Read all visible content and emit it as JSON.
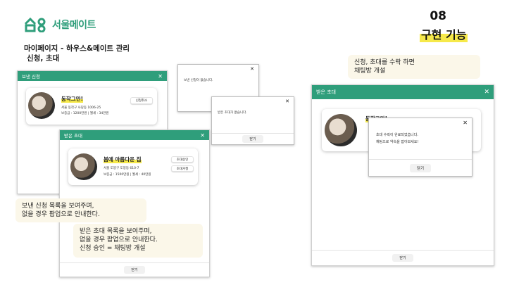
{
  "brand": {
    "name": "서울메이트"
  },
  "slide": {
    "number": "08",
    "title": "구현 기능"
  },
  "subtitle": {
    "line1": "마이페이지 - 하우스&메이트 관리",
    "line2": "신청, 초대"
  },
  "sent": {
    "header": "보낸 신청",
    "card": {
      "title": "동작그만!",
      "address": "서울 동작구 사당동 1006-25",
      "price": "보증금 : 1200만원 | 월세 : 34만원",
      "button": "신청취소"
    }
  },
  "popup_sent_empty": {
    "message": "보낸 신청이 없습니다."
  },
  "popup_received_empty": {
    "message": "받은 초대가 없습니다.",
    "button": "닫기"
  },
  "received": {
    "header": "받은 초대",
    "card": {
      "title": "봄에 아름다운 집",
      "address": "서울 도봉구 도봉동 610-7",
      "price": "보증금 : 1500만원 | 월세 : 40만원",
      "accept": "초대승인",
      "reject": "초대거절"
    },
    "close": "닫기"
  },
  "notes": {
    "sent": "보낸 신청 목록을 보여주며,\n없을 경우 팝업으로 안내한다.",
    "received": "받은 초대  목록을 보여주며,\n없을 경우 팝업으로 안내한다.\n신청 승인 = 채팅방 개설",
    "accept": "신청, 초대를 수락 하면\n채팅방 개설"
  },
  "right": {
    "header": "받은 초대",
    "card_title": "동작그만!",
    "popup": {
      "line1": "초대 수락이 완료되었습니다.",
      "line2": "채팅으로 약속을 잡아보세요!",
      "button": "닫기"
    },
    "close": "닫기"
  },
  "colors": {
    "accent": "#2f9e7b",
    "highlight": "#f6e94a",
    "note_bg": "#fbf7e9"
  }
}
